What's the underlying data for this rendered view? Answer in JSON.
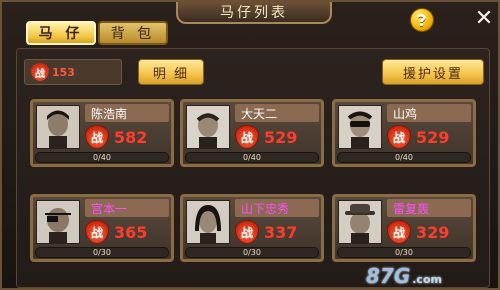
{
  "window": {
    "title": "马仔列表",
    "help_symbol": "?",
    "close_symbol": "✕"
  },
  "tabs": [
    {
      "label": "马 仔",
      "active": true
    },
    {
      "label": "背 包",
      "active": false
    }
  ],
  "summary": {
    "power_badge": "战",
    "total_power": "153",
    "details_button": "明 细",
    "support_button": "援护设置"
  },
  "cards": [
    {
      "name": "陈浩南",
      "name_color": "#ffffff",
      "power": "582",
      "progress": "0/40",
      "portrait": "man-short-hair-icon"
    },
    {
      "name": "大天二",
      "name_color": "#ffffff",
      "power": "529",
      "progress": "0/40",
      "portrait": "man-shaved-head-icon"
    },
    {
      "name": "山鸡",
      "name_color": "#ffffff",
      "power": "529",
      "progress": "0/40",
      "portrait": "man-sunglasses-icon"
    },
    {
      "name": "宫本一",
      "name_color": "#ff4dff",
      "power": "365",
      "progress": "0/30",
      "portrait": "man-eyepatch-icon"
    },
    {
      "name": "山下忠秀",
      "name_color": "#ff4dff",
      "power": "337",
      "progress": "0/30",
      "portrait": "man-long-hair-icon"
    },
    {
      "name": "雷复轰",
      "name_color": "#ff4dff",
      "power": "329",
      "progress": "0/30",
      "portrait": "man-hat-icon"
    }
  ],
  "watermark": {
    "text": "87G",
    "suffix": ".com"
  }
}
